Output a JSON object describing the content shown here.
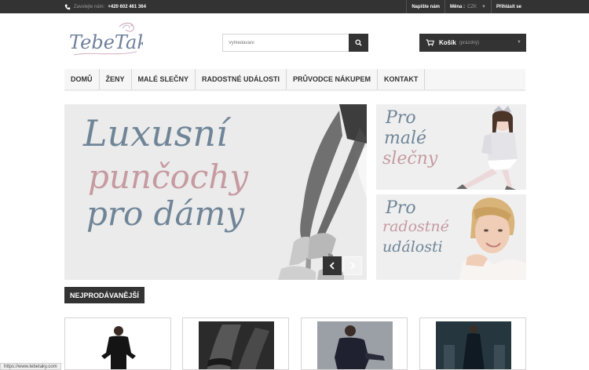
{
  "topbar": {
    "call_label": "Zavolejte nám:",
    "phone": "+420 602 461 364",
    "contact": "Napište nám",
    "currency_label": "Měna :",
    "currency_value": "CZK",
    "login": "Přihlásit se"
  },
  "logo": {
    "text": "TebeTaky"
  },
  "search": {
    "placeholder": "Vyhledávání"
  },
  "cart": {
    "title": "Košík",
    "status": "(prázdný)"
  },
  "menu": [
    "DOMŮ",
    "ŽENY",
    "MALÉ SLEČNY",
    "RADOSTNÉ UDÁLOSTI",
    "PRŮVODCE NÁKUPEM",
    "KONTAKT"
  ],
  "slider": {
    "line1": "Luxusní",
    "line2": "punčochy",
    "line3": "pro dámy"
  },
  "banner1": {
    "lines": [
      "Pro",
      "malé",
      "slečny"
    ]
  },
  "banner2": {
    "lines": [
      "Pro",
      "radostné",
      "události"
    ]
  },
  "section": {
    "title": "NEJPRODÁVANĚJŠÍ"
  },
  "statusbar": {
    "url": "https://www.tebetaky.com"
  },
  "colors": {
    "dark": "#333333",
    "blue_text": "#6f8597",
    "pink_text": "#c59aa0"
  }
}
